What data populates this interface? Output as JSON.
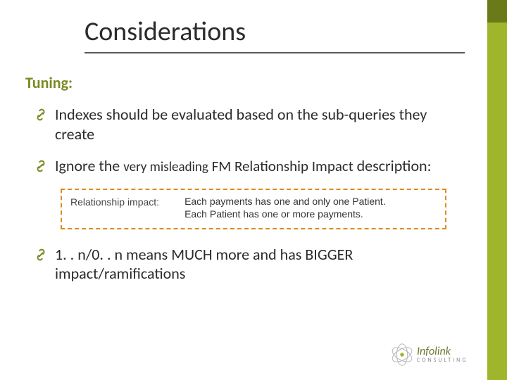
{
  "colors": {
    "accent_dark": "#6a7a18",
    "accent_light": "#9fb52c",
    "subhead": "#7a8a1f",
    "callout_border": "#e08a1e"
  },
  "title": "Considerations",
  "subhead": "Tuning:",
  "bullets": [
    {
      "text": "Indexes should be evaluated based on the sub-queries they create"
    },
    {
      "prefix": "Ignore the ",
      "small": "very misleading",
      "fm": " FM Relationship Impact ",
      "suffix": "description:"
    },
    {
      "text": "1. . n/0. . n means MUCH more and has BIGGER impact/ramifications"
    }
  ],
  "callout": {
    "label": "Relationship impact:",
    "line1": "Each payments has one and only one Patient.",
    "line2": "Each Patient has one or more payments."
  },
  "logo": {
    "main": "Infolink",
    "sub": "CONSULTING"
  }
}
